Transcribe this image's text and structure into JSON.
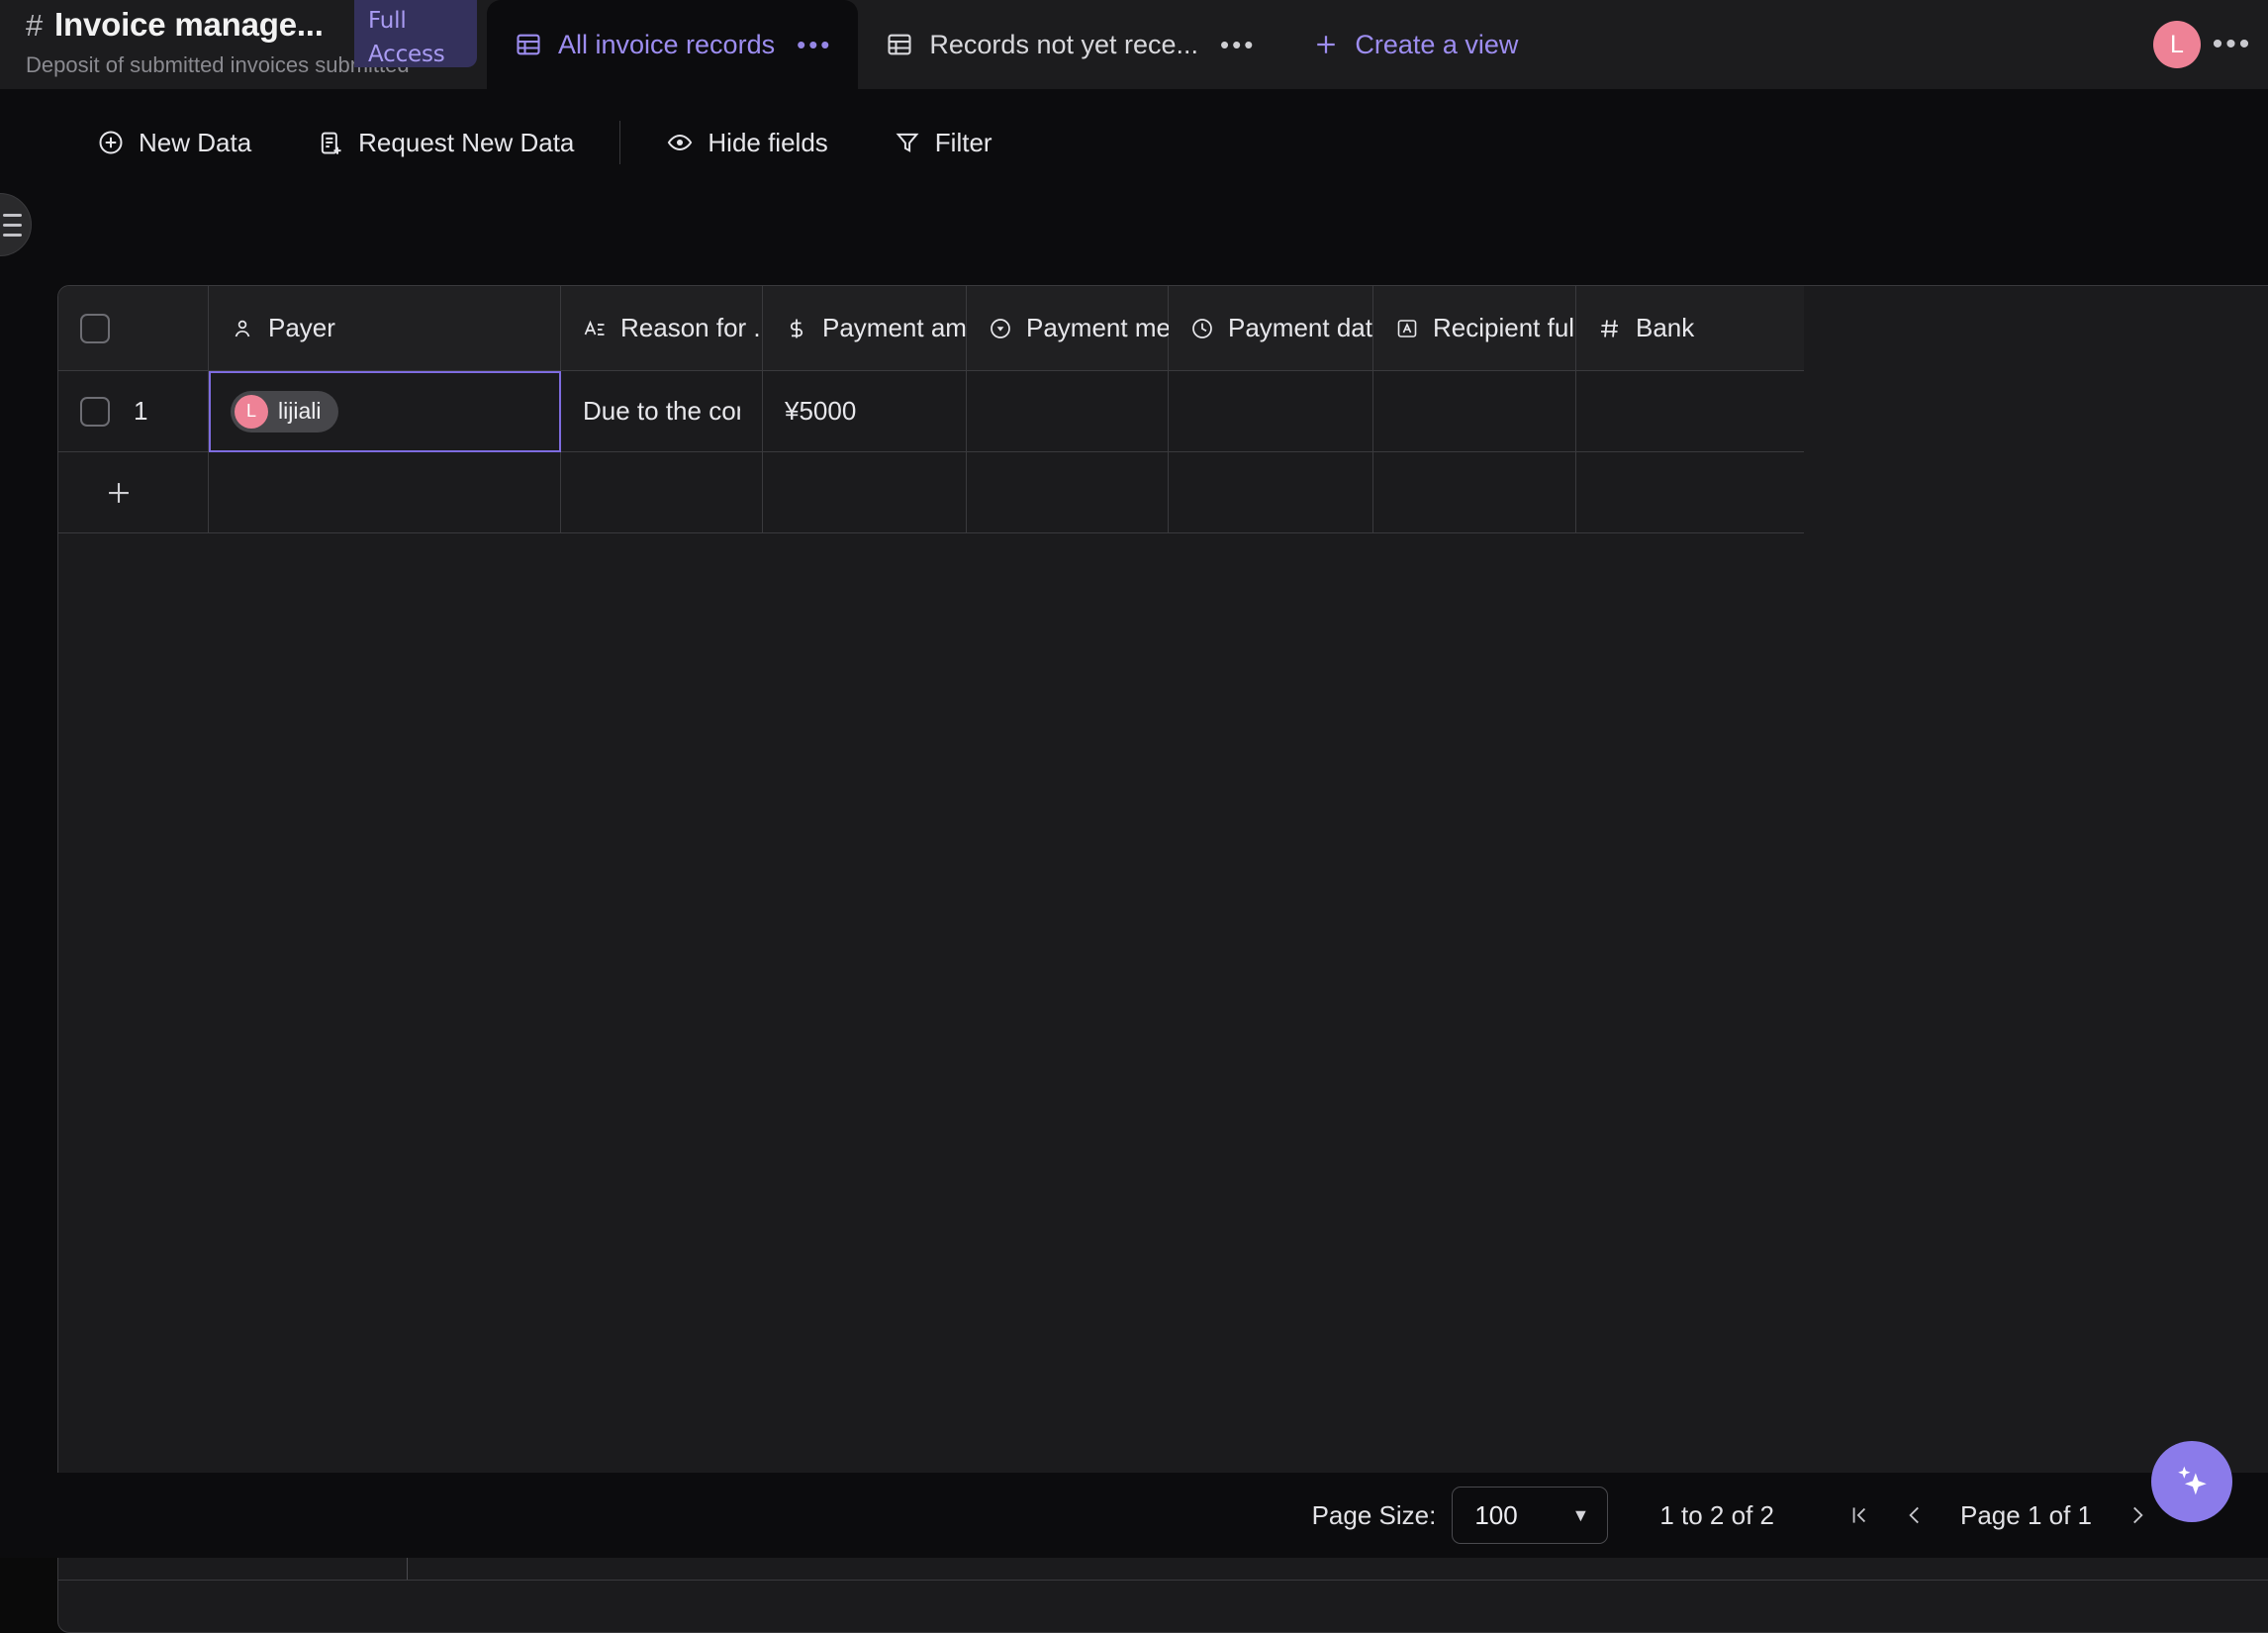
{
  "header": {
    "hash_icon": "hash-icon",
    "doc_title": "Invoice manage...",
    "doc_subtitle": "Deposit of submitted invoices submitted",
    "access_badge_line1": "Full",
    "access_badge_line2": "Access",
    "avatar_initial": "L",
    "more_dots": "•••",
    "tabs": [
      {
        "label": "All invoice records",
        "icon": "table-icon",
        "menu": "•••",
        "active": true
      },
      {
        "label": "Records not yet rece...",
        "icon": "table-icon",
        "menu": "•••",
        "active": false
      }
    ],
    "create_view_label": "Create a view",
    "create_view_icon": "plus-icon"
  },
  "toolbar": {
    "new_data": "New Data",
    "request_new_data": "Request New Data",
    "hide_fields": "Hide fields",
    "filter": "Filter"
  },
  "table": {
    "columns": [
      {
        "label": "Payer",
        "icon": "person-icon"
      },
      {
        "label": "Reason for ...",
        "icon": "text-icon"
      },
      {
        "label": "Payment am...",
        "icon": "currency-icon"
      },
      {
        "label": "Payment me...",
        "icon": "select-icon"
      },
      {
        "label": "Payment date",
        "icon": "clock-icon"
      },
      {
        "label": "Recipient ful...",
        "icon": "text-box-icon"
      },
      {
        "label": "Bank",
        "icon": "number-icon"
      }
    ],
    "rows": [
      {
        "index": "1",
        "payer": "lijiali",
        "payer_avatar": "L",
        "reason": "Due to the com...",
        "amount": "¥5000",
        "method": "",
        "date": "",
        "recipient": "",
        "bank": ""
      }
    ],
    "add_row_icon": "plus-icon"
  },
  "footer": {
    "page_size_label": "Page Size:",
    "page_size_value": "100",
    "caret": "▼",
    "range_text": "1 to 2 of 2",
    "first_icon": "❘‹",
    "prev_icon": "‹",
    "page_text": "Page 1 of 1",
    "next_icon": "›"
  },
  "fab": {
    "icon": "sparkle-icon"
  },
  "colors": {
    "accent": "#8b7bea",
    "tab_active_text": "#9d8df0",
    "avatar_pink": "#ee8296",
    "badge_bg": "#34315c",
    "grid_bg": "#1b1b1d",
    "grid_border": "#3a3a3d",
    "selection": "#7e6ce0"
  }
}
